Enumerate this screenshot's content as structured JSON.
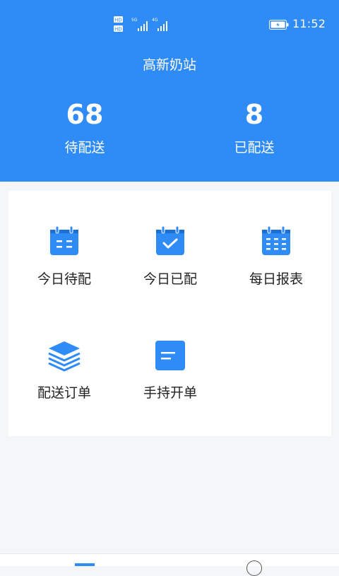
{
  "statusbar": {
    "net_labels": {
      "hd1": "HD",
      "hd2": "HD",
      "five_g": "5G",
      "four_g": "4G"
    },
    "time": "11:52",
    "icons": [
      "hd-icon",
      "5g-signal-icon",
      "4g-signal-icon",
      "battery-icon"
    ]
  },
  "header": {
    "title": "高新奶站",
    "stats": [
      {
        "value": "68",
        "label": "待配送"
      },
      {
        "value": "8",
        "label": "已配送"
      }
    ]
  },
  "menu": {
    "tiles": [
      {
        "label": "今日待配",
        "icon": "calendar-icon"
      },
      {
        "label": "今日已配",
        "icon": "calendar-check-icon"
      },
      {
        "label": "每日报表",
        "icon": "calendar-grid-icon"
      },
      {
        "label": "配送订单",
        "icon": "layers-icon"
      },
      {
        "label": "手持开单",
        "icon": "document-icon"
      }
    ]
  },
  "colors": {
    "primary": "#2f8bf5",
    "background": "#f5f6f7",
    "card": "#ffffff",
    "text": "#222222"
  }
}
